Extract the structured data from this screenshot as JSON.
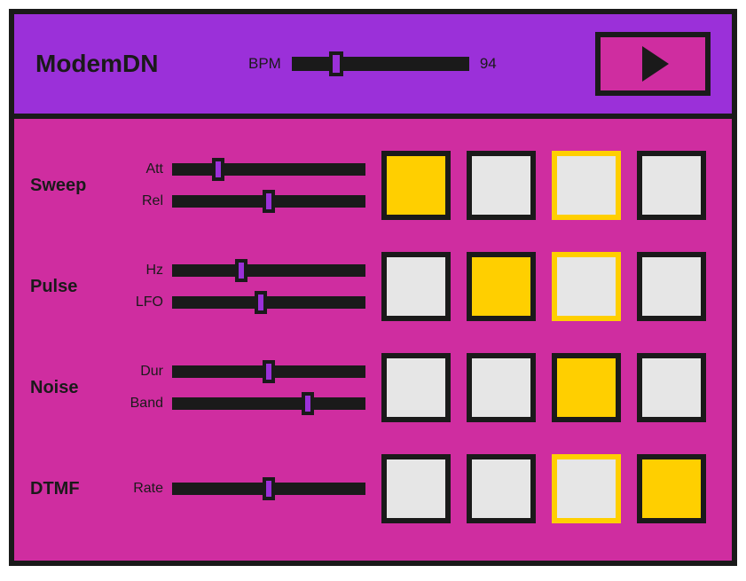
{
  "header": {
    "title": "ModemDN",
    "bpm_label": "BPM",
    "bpm_value": "94",
    "bpm_pos_pct": 25
  },
  "active_step": 2,
  "tracks": [
    {
      "name": "Sweep",
      "controls": [
        {
          "label": "Att",
          "pos_pct": 24
        },
        {
          "label": "Rel",
          "pos_pct": 50
        }
      ],
      "steps": [
        true,
        false,
        false,
        false
      ]
    },
    {
      "name": "Pulse",
      "controls": [
        {
          "label": "Hz",
          "pos_pct": 36
        },
        {
          "label": "LFO",
          "pos_pct": 46
        }
      ],
      "steps": [
        false,
        true,
        false,
        false
      ]
    },
    {
      "name": "Noise",
      "controls": [
        {
          "label": "Dur",
          "pos_pct": 50
        },
        {
          "label": "Band",
          "pos_pct": 70
        }
      ],
      "steps": [
        false,
        false,
        true,
        false
      ]
    },
    {
      "name": "DTMF",
      "controls": [
        {
          "label": "Rate",
          "pos_pct": 50
        }
      ],
      "steps": [
        false,
        false,
        false,
        true
      ]
    }
  ]
}
